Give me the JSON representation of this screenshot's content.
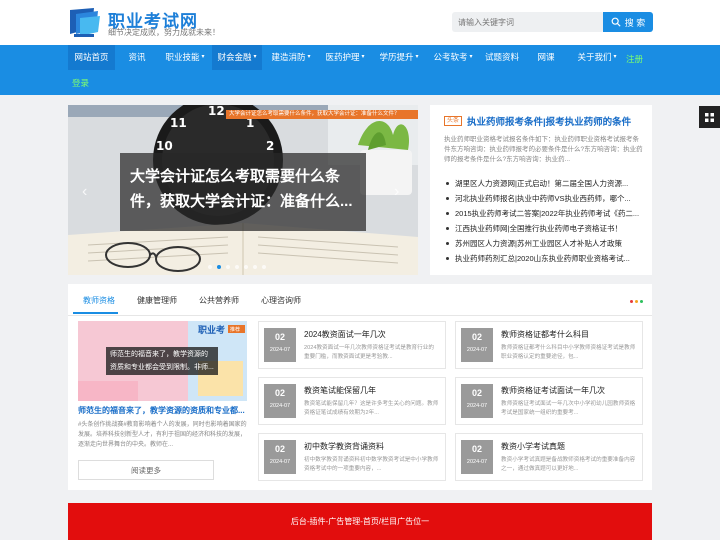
{
  "site": {
    "title": "职业考试网",
    "slogan": "细节决定成败，努力成就未来！",
    "search_placeholder": "请输入关键字词",
    "search_button": "搜 索"
  },
  "nav": {
    "items": [
      "网站首页",
      "资讯",
      "职业技能",
      "财会金融",
      "建造消防",
      "医药护理",
      "学历提升",
      "公考软考",
      "试题资料",
      "网课",
      "关于我们"
    ],
    "register": "注册",
    "login": "登录"
  },
  "slider": {
    "banner": "大学会计证怎么考取需要什么条件，获取大学会计证：准备什么文件？",
    "caption": "大学会计证怎么考取需要什么条件，获取大学会计证：准备什么...",
    "dot_count": 7,
    "active_dot": 1
  },
  "headline": {
    "tag": "头条",
    "title": "执业药师报考条件|报考执业药师的条件",
    "desc": "执业药师职业资格考试报名条件如下：执业药师职业资格考试报考条件东方响咨询：执业药师报考的必要条件是什么?东方响咨询：执业药师的报考条件是什么?东方响咨询：执业药...",
    "list": [
      "湖里区人力资源网|正式启动！第二届全国人力资源...",
      "河北执业药师报名|执业中药师VS执业西药师，哪个...",
      "2015执业药师考试二答案|2022年执业药师考试《药二...",
      "江西执业药师网|全国推行执业药师电子资格证书！",
      "苏州园区人力资源|苏州工业园区人才补贴人才政策",
      "执业药师药剂汇总|2020山东执业药师职业资格考试..."
    ]
  },
  "tabs": {
    "items": [
      "教师资格",
      "健康管理师",
      "公共营养师",
      "心理咨询师"
    ],
    "active": 0,
    "dot_colors": [
      "#e83a3a",
      "#f5a623",
      "#2cbf5c"
    ]
  },
  "feature": {
    "image_badge": "推荐",
    "image_text": "职业考",
    "caption": "师范生的福音来了，教学资源的资质和专业都会受到限制。非师...",
    "title": "师范生的福音来了，教学资源的资质和专业都...",
    "desc": "#头条创作挑战赛#教育影响着个人的发展，同时也影响着国家的发展。培养科技创新型人才，有利于祖国的经济和科技的发展，逐渐走向世界舞台的中央。教师在...",
    "read_more": "阅读更多"
  },
  "cards": [
    {
      "day": "02",
      "ym": "2024-07",
      "title": "2024教资面试一年几次",
      "desc": "2024教资面试一年几次教师资格证考试是教育行业的重要门槛，而教资面试更是考验教..."
    },
    {
      "day": "02",
      "ym": "2024-07",
      "title": "教师资格证都考什么科目",
      "desc": "教师资格证都考什么科目中小学教师资格证考试是教师职业资格认定的重要途径，包..."
    },
    {
      "day": "02",
      "ym": "2024-07",
      "title": "教资笔试能保留几年",
      "desc": "教资笔试能保留几年？这是许多考生关心的问题。教师资格证笔试成绩有效期为2年..."
    },
    {
      "day": "02",
      "ym": "2024-07",
      "title": "教师资格证考试面试一年几次",
      "desc": "教师资格证考试面试一年几次中小学初幼儿园教师资格考试是国家统一组织的重要考..."
    },
    {
      "day": "02",
      "ym": "2024-07",
      "title": "初中数学教资背诵资料",
      "desc": "初中数学教资背诵资料初中数学教资考试是中小学教师资格考试中的一项重要内容，..."
    },
    {
      "day": "02",
      "ym": "2024-07",
      "title": "教资小学考试真题",
      "desc": "教资小学考试真题是备战教师资格考试的重要准备内容之一，通过做真题可以更好地..."
    }
  ],
  "ad": {
    "text": "后台-插件-广告管理-首页/栏目广告位一"
  },
  "colors": {
    "brand": "#1a8de3",
    "nav_active": "#147ad0",
    "ad": "#e20d0d",
    "accent_orange": "#e8752a"
  }
}
